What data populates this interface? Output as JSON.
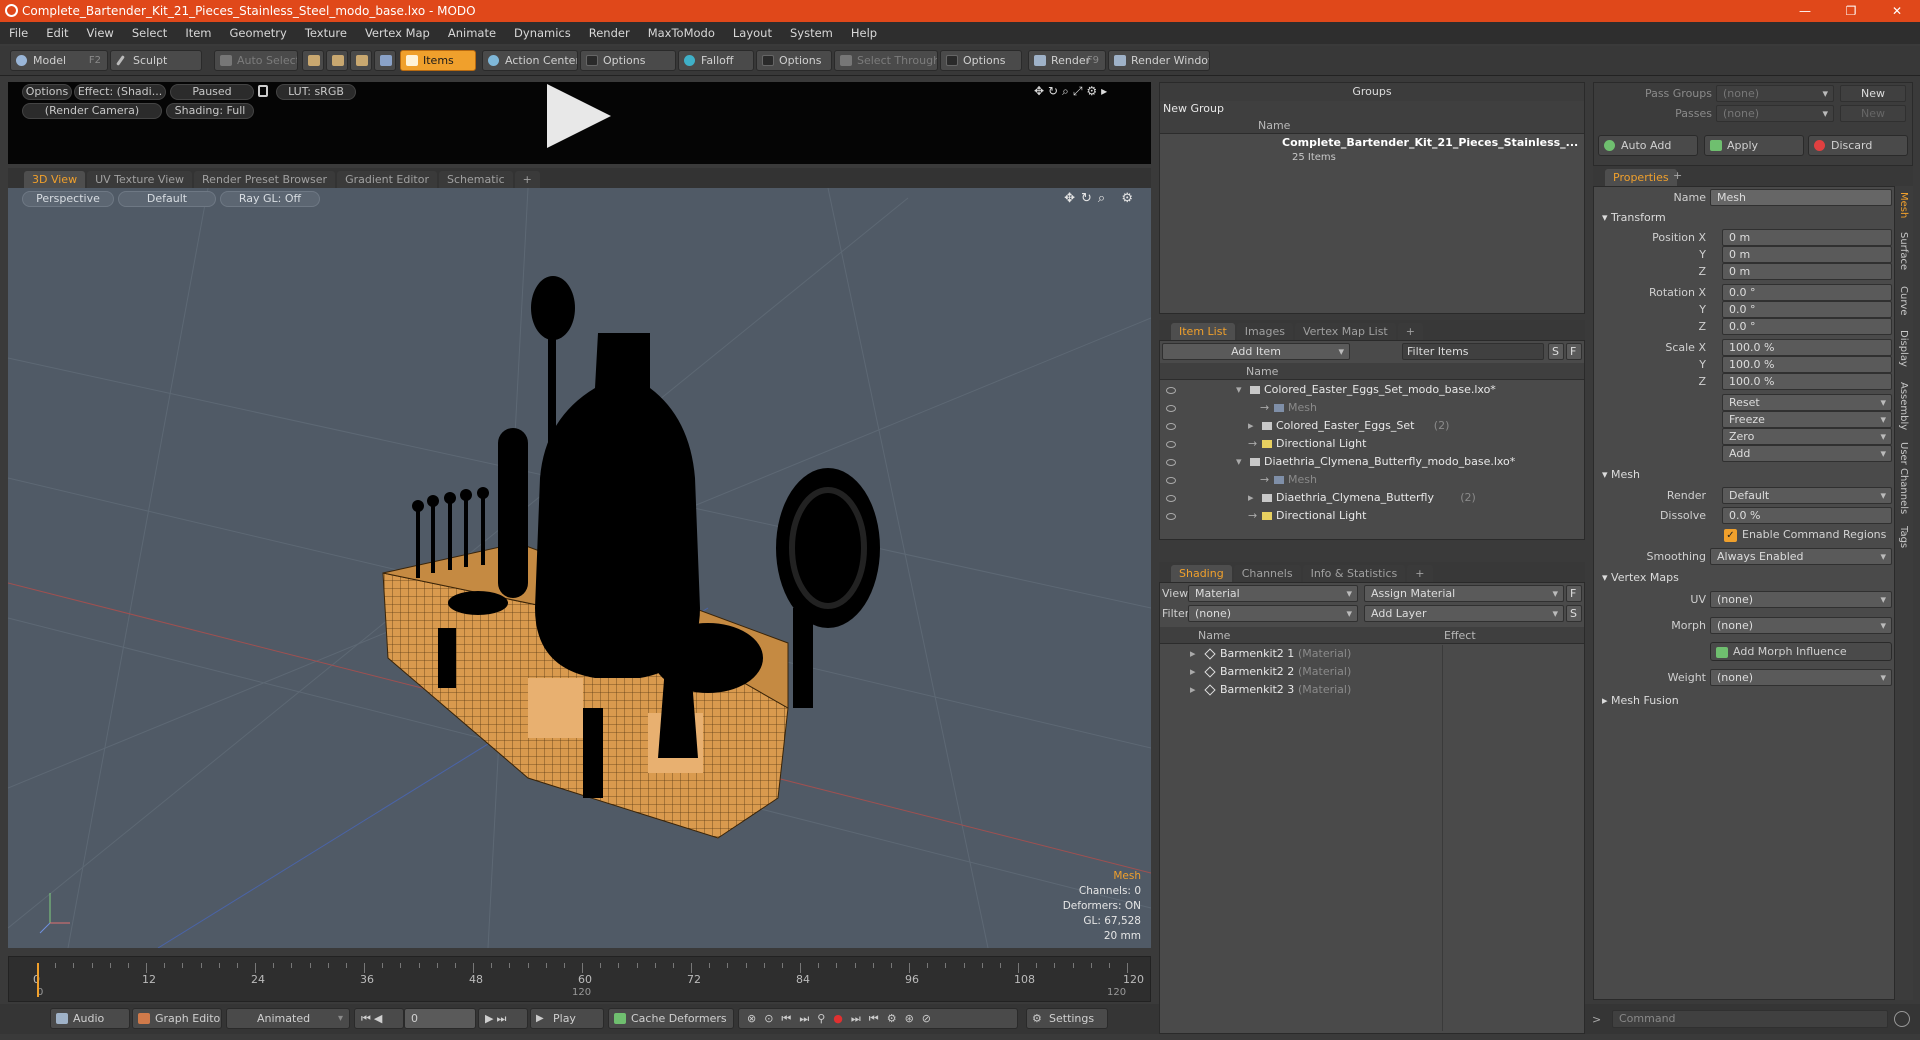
{
  "window": {
    "title": "Complete_Bartender_Kit_21_Pieces_Stainless_Steel_modo_base.lxo - MODO"
  },
  "menu": [
    "File",
    "Edit",
    "View",
    "Select",
    "Item",
    "Geometry",
    "Texture",
    "Vertex Map",
    "Animate",
    "Dynamics",
    "Render",
    "MaxToModo",
    "Layout",
    "System",
    "Help"
  ],
  "toolbar": {
    "model": "Model",
    "model_key": "F2",
    "sculpt": "Sculpt",
    "auto_select": "Auto Select",
    "items": "Items",
    "action_center": "Action Center",
    "options1": "Options",
    "falloff": "Falloff",
    "options2": "Options",
    "select_through": "Select Through",
    "options3": "Options",
    "render": "Render",
    "render_key": "F9",
    "render_window": "Render Window"
  },
  "viewer": {
    "options": "Options",
    "effect": "Effect: (Shadi...",
    "paused": "Paused",
    "lut": "LUT: sRGB",
    "camera": "(Render Camera)",
    "shading": "Shading: Full"
  },
  "view_tabs": [
    "3D View",
    "UV Texture View",
    "Render Preset Browser",
    "Gradient Editor",
    "Schematic",
    "+"
  ],
  "viewport": {
    "perspective": "Perspective",
    "default": "Default",
    "raygl": "Ray GL: Off",
    "info": {
      "mesh": "Mesh",
      "channels": "Channels: 0",
      "deformers": "Deformers: ON",
      "gl": "GL: 67,528",
      "scale": "20 mm"
    }
  },
  "timeline": {
    "major": [
      "0",
      "12",
      "24",
      "36",
      "48",
      "60",
      "72",
      "84",
      "96",
      "108",
      "120"
    ],
    "sub_start": "0",
    "sub_mid": "120",
    "sub_end": "120"
  },
  "bottom": {
    "audio": "Audio",
    "graph_editor": "Graph Editor",
    "animated": "Animated",
    "frame": "0",
    "play": "Play",
    "cache": "Cache Deformers",
    "settings": "Settings",
    "command": "Command"
  },
  "groups": {
    "title": "Groups",
    "new_group": "New Group",
    "col_name": "Name",
    "item_name": "Complete_Bartender_Kit_21_Pieces_Stainless_...",
    "item_count": "25 Items"
  },
  "itemlist": {
    "tabs": [
      "Item List",
      "Images",
      "Vertex Map List",
      "+"
    ],
    "add_item": "Add Item",
    "filter": "Filter Items",
    "s": "S",
    "f": "F",
    "col_name": "Name",
    "rows": [
      {
        "text": "Colored_Easter_Eggs_Set_modo_base.lxo*",
        "indent": 0,
        "kind": "scene"
      },
      {
        "text": "Mesh",
        "indent": 2,
        "kind": "mesh"
      },
      {
        "text": "Colored_Easter_Eggs_Set",
        "count": "(2)",
        "indent": 1,
        "kind": "group"
      },
      {
        "text": "Directional Light",
        "indent": 1,
        "kind": "light"
      },
      {
        "text": "Diaethria_Clymena_Butterfly_modo_base.lxo*",
        "indent": 0,
        "kind": "scene"
      },
      {
        "text": "Mesh",
        "indent": 2,
        "kind": "mesh"
      },
      {
        "text": "Diaethria_Clymena_Butterfly",
        "count": "(2)",
        "indent": 1,
        "kind": "group"
      },
      {
        "text": "Directional Light",
        "indent": 1,
        "kind": "light"
      }
    ]
  },
  "shading": {
    "tabs": [
      "Shading",
      "Channels",
      "Info & Statistics",
      "+"
    ],
    "view_label": "View",
    "view_value": "Material",
    "assign": "Assign Material",
    "f": "F",
    "filter_label": "Filter",
    "filter_value": "(none)",
    "add_layer": "Add Layer",
    "s": "S",
    "col_name": "Name",
    "col_effect": "Effect",
    "rows": [
      {
        "name": "Barmenkit2 1",
        "type": "(Material)"
      },
      {
        "name": "Barmenkit2 2",
        "type": "(Material)"
      },
      {
        "name": "Barmenkit2 3",
        "type": "(Material)"
      }
    ]
  },
  "passes": {
    "pass_groups": "Pass Groups",
    "passes": "Passes",
    "none": "(none)",
    "new": "New",
    "auto_add": "Auto Add",
    "apply": "Apply",
    "discard": "Discard"
  },
  "properties": {
    "tab": "Properties",
    "plus": "+",
    "name_label": "Name",
    "name_value": "Mesh",
    "transform": "Transform",
    "position": {
      "label": "Position X",
      "y": "Y",
      "z": "Z",
      "vals": [
        "0 m",
        "0 m",
        "0 m"
      ]
    },
    "rotation": {
      "label": "Rotation X",
      "y": "Y",
      "z": "Z",
      "vals": [
        "0.0 °",
        "0.0 °",
        "0.0 °"
      ]
    },
    "scale": {
      "label": "Scale X",
      "y": "Y",
      "z": "Z",
      "vals": [
        "100.0 %",
        "100.0 %",
        "100.0 %"
      ]
    },
    "actions": [
      "Reset",
      "Freeze",
      "Zero",
      "Add"
    ],
    "mesh": "Mesh",
    "render_label": "Render",
    "render_value": "Default",
    "dissolve_label": "Dissolve",
    "dissolve_value": "0.0 %",
    "enable_cmd": "Enable Command Regions",
    "smoothing_label": "Smoothing",
    "smoothing_value": "Always Enabled",
    "vertex_maps": "Vertex Maps",
    "uv_label": "UV",
    "uv_value": "(none)",
    "morph_label": "Morph",
    "morph_value": "(none)",
    "add_morph": "Add Morph Influence",
    "weight_label": "Weight",
    "weight_value": "(none)",
    "mesh_fusion": "Mesh Fusion",
    "side_tabs": [
      "Mesh",
      "Surface",
      "Curve",
      "Display",
      "Assembly",
      "User Channels",
      "Tags"
    ]
  },
  "colors": {
    "accent": "#f0a02c",
    "titlebar": "#e0481a",
    "viewport": "#505a66",
    "wood": "#d99a4e"
  }
}
